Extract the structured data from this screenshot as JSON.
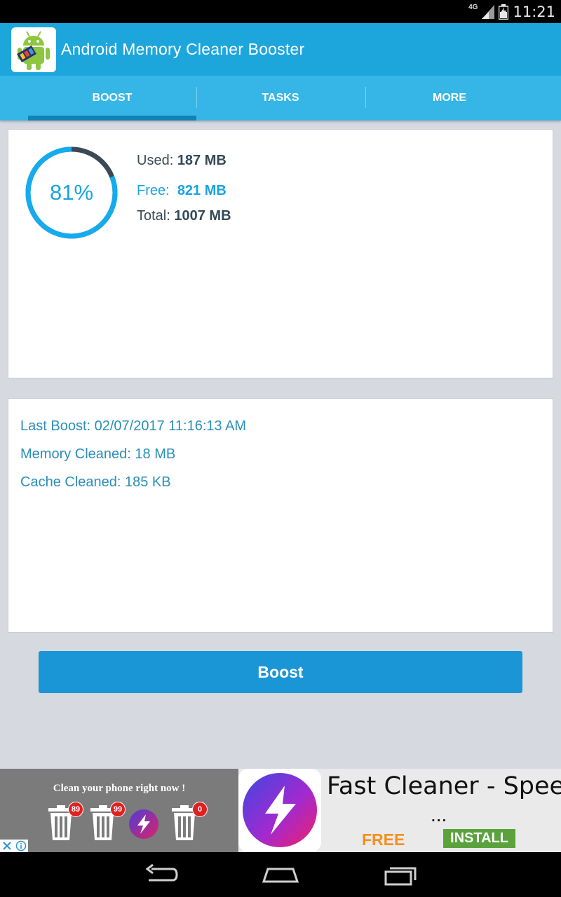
{
  "status_bar": {
    "network": "4G",
    "time": "11:21"
  },
  "app_bar": {
    "title": "Android Memory Cleaner Booster"
  },
  "tabs": [
    {
      "label": "BOOST",
      "active": true
    },
    {
      "label": "TASKS",
      "active": false
    },
    {
      "label": "MORE",
      "active": false
    }
  ],
  "memory": {
    "percent_label": "81%",
    "percent_value": 81,
    "used_label": "Used:",
    "used_value": "187 MB",
    "free_label": "Free:",
    "free_value": "821 MB",
    "total_label": "Total:",
    "total_value": "1007 MB"
  },
  "boost_info": {
    "last_boost": "Last Boost: 02/07/2017 11:16:13 AM",
    "memory_cleaned": "Memory Cleaned: 18 MB",
    "cache_cleaned": "Cache Cleaned: 185 KB"
  },
  "boost_button": {
    "label": "Boost"
  },
  "ad": {
    "tagline": "Clean your phone right now !",
    "badges": [
      "89",
      "99",
      "0"
    ],
    "title": "Fast Cleaner - Speed",
    "ellipsis": "...",
    "price": "FREE",
    "install_label": "INSTALL"
  },
  "colors": {
    "primary": "#1da6dc",
    "tab_bar": "#36b6e6",
    "tab_indicator": "#1182b8",
    "accent": "#1aa3e0",
    "button": "#1a96d7",
    "install_green": "#5aa33c",
    "free_orange": "#f4901e"
  },
  "icons": [
    "signal-icon",
    "battery-icon",
    "app-logo-icon",
    "trash-icon",
    "lightning-icon",
    "ad-close-icon",
    "ad-info-icon",
    "back-icon",
    "home-icon",
    "recents-icon"
  ]
}
